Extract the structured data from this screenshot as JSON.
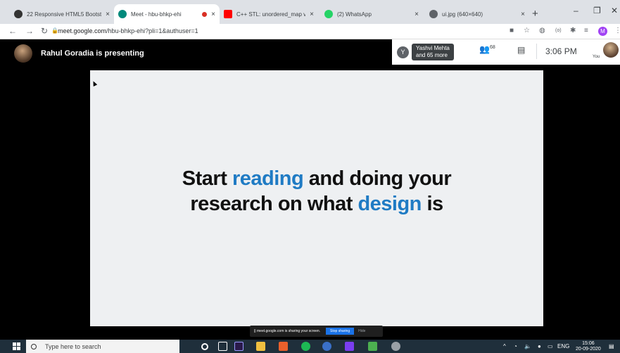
{
  "browser": {
    "tabs": [
      {
        "title": "22 Responsive HTML5 Bootstr",
        "icon": "site-icon",
        "active": false
      },
      {
        "title": "Meet - hbu-bhkp-ehi",
        "icon": "meet-icon",
        "active": true,
        "recording": true
      },
      {
        "title": "C++ STL: unordered_map v/s",
        "icon": "youtube-icon",
        "active": false
      },
      {
        "title": "(2) WhatsApp",
        "icon": "whatsapp-icon",
        "active": false
      },
      {
        "title": "ui.jpg (640×640)",
        "icon": "globe-icon",
        "active": false
      }
    ],
    "new_tab": "+",
    "close": "×",
    "url_host": "meet.google.com",
    "url_path": "/hbu-bhkp-ehi?pli=1&authuser=1",
    "profile_initial": "M"
  },
  "meet": {
    "presenting_text": "Rahul Goradia is presenting",
    "participant_initial": "Y",
    "participant_names": "Yashvi Mehta",
    "participant_more": "and 65 more",
    "people_count": "68",
    "time": "3:06 PM",
    "you_label": "You",
    "slide_line1_a": "Start ",
    "slide_line1_hl": "reading",
    "slide_line1_b": " and doing your",
    "slide_line2_a": "research on what ",
    "slide_line2_hl": "design",
    "slide_line2_b": " is",
    "sharing_message": "meet.google.com is sharing your screen.",
    "stop_sharing": "Stop sharing",
    "hide": "Hide"
  },
  "taskbar": {
    "search_placeholder": "Type here to search",
    "language": "ENG",
    "clock_time": "15:06",
    "clock_date": "20-09-2020"
  },
  "colors": {
    "accent_blue": "#1f7bc4",
    "stop_button": "#1a73e8",
    "taskbar": "#1f2f3b"
  }
}
